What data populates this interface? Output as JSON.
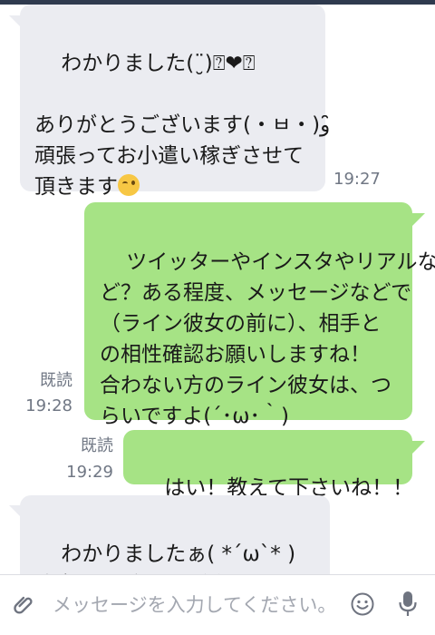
{
  "messages": [
    {
      "id": "m1",
      "side": "in",
      "text": "わかりました(¨̮)⍰❤⍰\n\nありがとうございます(・ㅂ・)و ̑̑\n頑張ってお小遣い稼ぎさせて\n頂きます",
      "time": "19:27",
      "trailing_emoji": "wink-emoji"
    },
    {
      "id": "m2",
      "side": "out",
      "text": "ツイッターやインスタやリアルな\nど？ある程度、メッセージなどで\n（ライン彼女の前に）、相手と\nの相性確認お願いしますね！\n合わない方のライン彼女は、つ\nらいですよ(´･ω･｀)",
      "read": "既読",
      "time": "19:28"
    },
    {
      "id": "m3",
      "side": "out",
      "text": "はい！教えて下さいね！！",
      "read": "既読",
      "time": "19:29"
    },
    {
      "id": "m4",
      "side": "in",
      "text": "わかりましたぁ( *´ω`* )\n注意しながら、お誘いしていき"
    }
  ],
  "input": {
    "placeholder": "メッセージを入力してください。",
    "value": ""
  },
  "icons": {
    "attach": "paperclip-icon",
    "emoji": "smiley-icon",
    "mic": "microphone-icon"
  },
  "colors": {
    "incoming_bubble": "#ebecf1",
    "outgoing_bubble": "#a6e385",
    "meta_text": "#707784",
    "placeholder": "#a3a7b0"
  }
}
